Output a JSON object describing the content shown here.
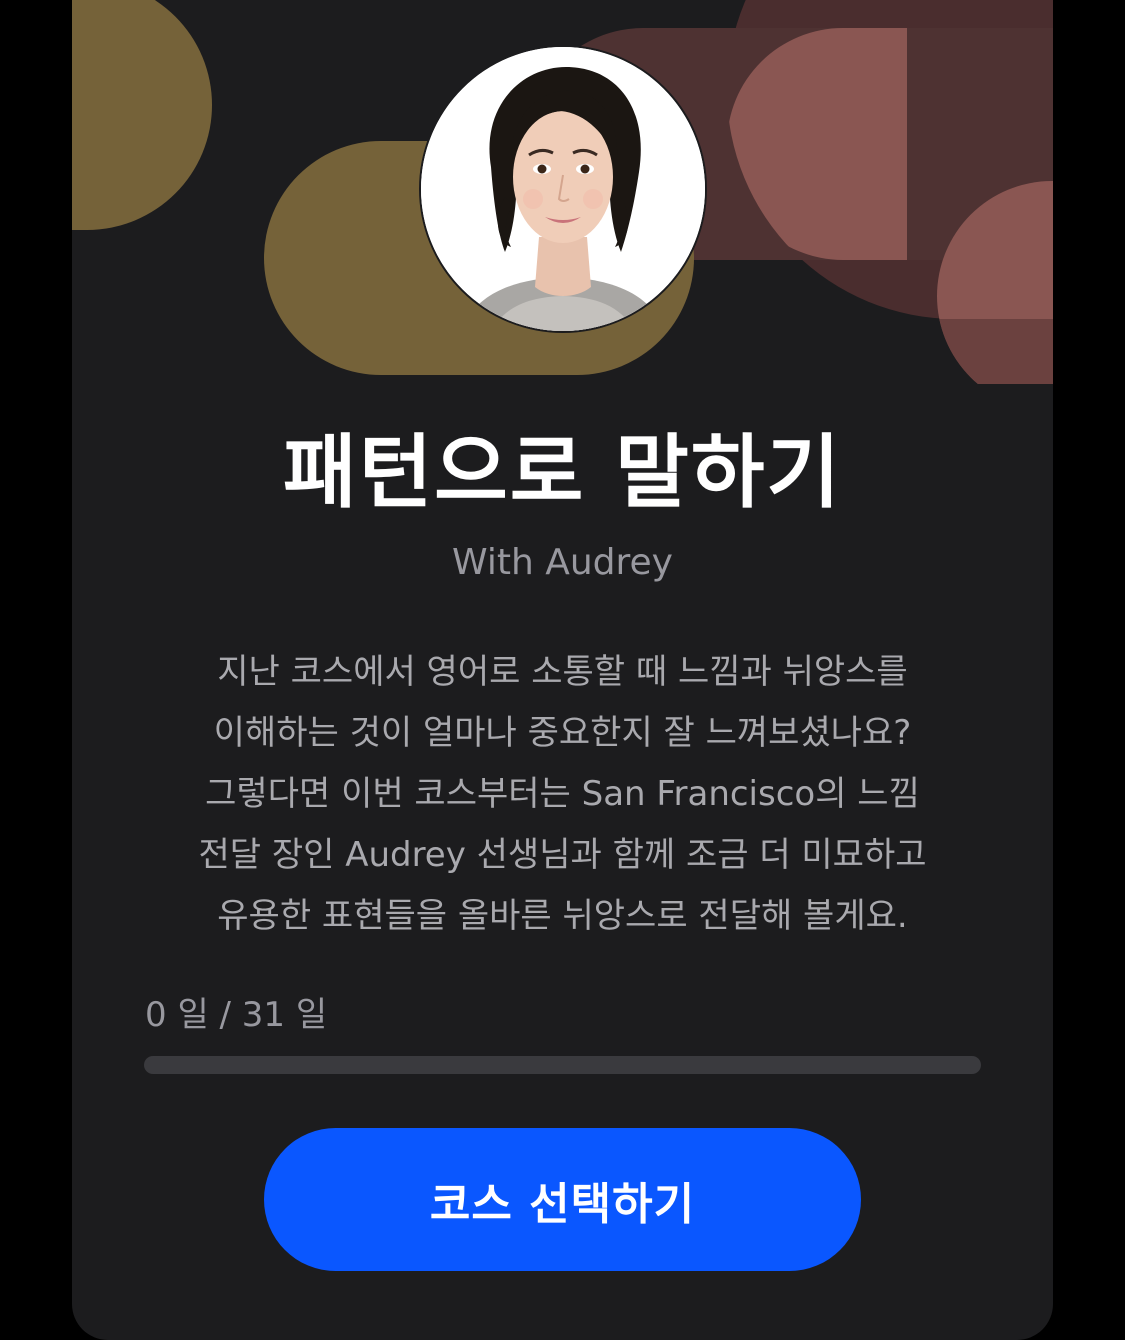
{
  "course": {
    "title": "패턴으로 말하기",
    "subtitle": "With Audrey",
    "instructor_photo": "instructor-portrait",
    "description_lines": [
      "지난 코스에서 영어로 소통할 때 느낌과 뉘앙스를",
      "이해하는 것이 얼마나 중요한지 잘 느껴보셨나요?",
      "그렇다면 이번 코스부터는 San Francisco의 느낌",
      "전달 장인 Audrey 선생님과 함께 조금 더 미묘하고",
      "유용한 표현들을 올바른 뉘앙스로 전달해 볼게요."
    ]
  },
  "progress": {
    "label": "0 일 / 31 일",
    "days_completed": 0,
    "days_total": 31
  },
  "cta": {
    "label": "코스 선택하기"
  },
  "colors": {
    "background": "#1c1c1e",
    "accent": "#0a57ff",
    "gold_shape": "#756239",
    "rose_shape": "#8a5652",
    "progress_track": "#3a3a3e"
  }
}
